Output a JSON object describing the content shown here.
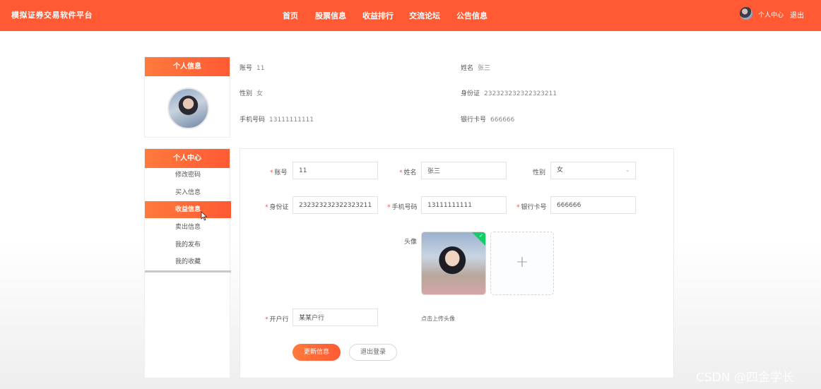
{
  "header": {
    "brand": "模拟证券交易软件平台",
    "nav": [
      "首页",
      "股票信息",
      "收益排行",
      "交流论坛",
      "公告信息"
    ],
    "user_center": "个人中心",
    "logout": "退出"
  },
  "sidebar": {
    "info_title": "个人信息",
    "center_title": "个人中心",
    "menu": [
      "修改密码",
      "买入信息",
      "收益信息",
      "卖出信息",
      "我的发布",
      "我的收藏"
    ],
    "active_index": 2
  },
  "summary": {
    "account_label": "账号",
    "account": "11",
    "name_label": "姓名",
    "name": "张三",
    "gender_label": "性别",
    "gender": "女",
    "id_label": "身份证",
    "id": "232323232322323211",
    "phone_label": "手机号码",
    "phone": "13111111111",
    "bank_label": "银行卡号",
    "bank": "666666"
  },
  "form": {
    "account_label": "账号",
    "account": "11",
    "name_label": "姓名",
    "name": "张三",
    "gender_label": "性别",
    "gender": "女",
    "id_label": "身份证",
    "id": "232323232322323211",
    "phone_label": "手机号码",
    "phone": "13111111111",
    "bank_label": "银行卡号",
    "bank": "666666",
    "avatar_label": "头像",
    "upload_hint": "点击上传头像",
    "branch_label": "开户行",
    "branch": "某某户行",
    "update_button": "更新信息",
    "logout_button": "退出登录"
  },
  "watermark": "CSDN @四金学长",
  "colors": {
    "accent": "#ff5a34",
    "accent_light": "#ff7a3c",
    "success": "#13ce66",
    "required": "#ff4d4f"
  }
}
